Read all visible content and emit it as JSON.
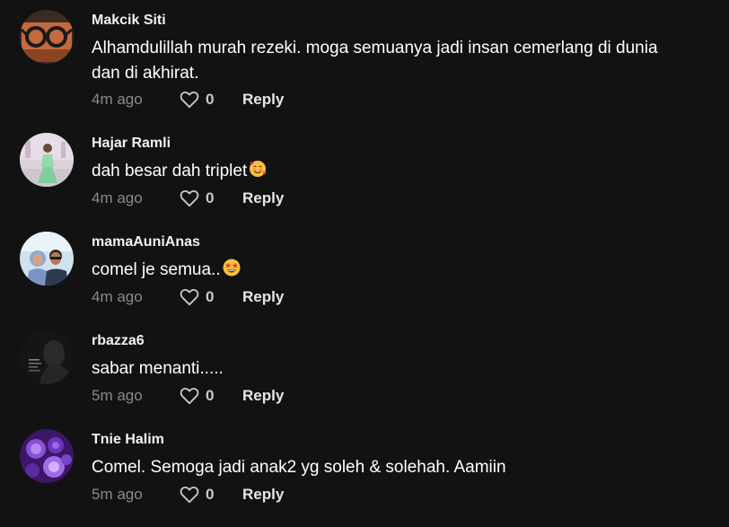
{
  "comments": [
    {
      "username": "Makcik Siti",
      "text": "Alhamdulillah murah rezeki. moga semuanya jadi insan cemerlang di dunia dan di akhirat.",
      "time": "4m ago",
      "likes": "0",
      "reply_label": "Reply",
      "avatar": "glasses-on-wood-avatar"
    },
    {
      "username": "Hajar Ramli",
      "text": "dah besar dah triplet",
      "emoji": "smiling-face-with-hearts",
      "time": "4m ago",
      "likes": "0",
      "reply_label": "Reply",
      "avatar": "woman-in-green-dress-avatar"
    },
    {
      "username": "mamaAuniAnas",
      "text": "comel je semua..",
      "emoji": "star-struck",
      "time": "4m ago",
      "likes": "0",
      "reply_label": "Reply",
      "avatar": "couple-selfie-avatar"
    },
    {
      "username": "rbazza6",
      "text": "sabar menanti.....",
      "time": "5m ago",
      "likes": "0",
      "reply_label": "Reply",
      "avatar": "dark-portrait-avatar"
    },
    {
      "username": "Tnie Halim",
      "text": "Comel. Semoga jadi anak2 yg soleh & solehah. Aamiin",
      "time": "5m ago",
      "likes": "0",
      "reply_label": "Reply",
      "avatar": "purple-roses-avatar"
    }
  ],
  "colors": {
    "background": "#121212",
    "timestamp": "#8a8a8a",
    "text": "#ffffff"
  }
}
